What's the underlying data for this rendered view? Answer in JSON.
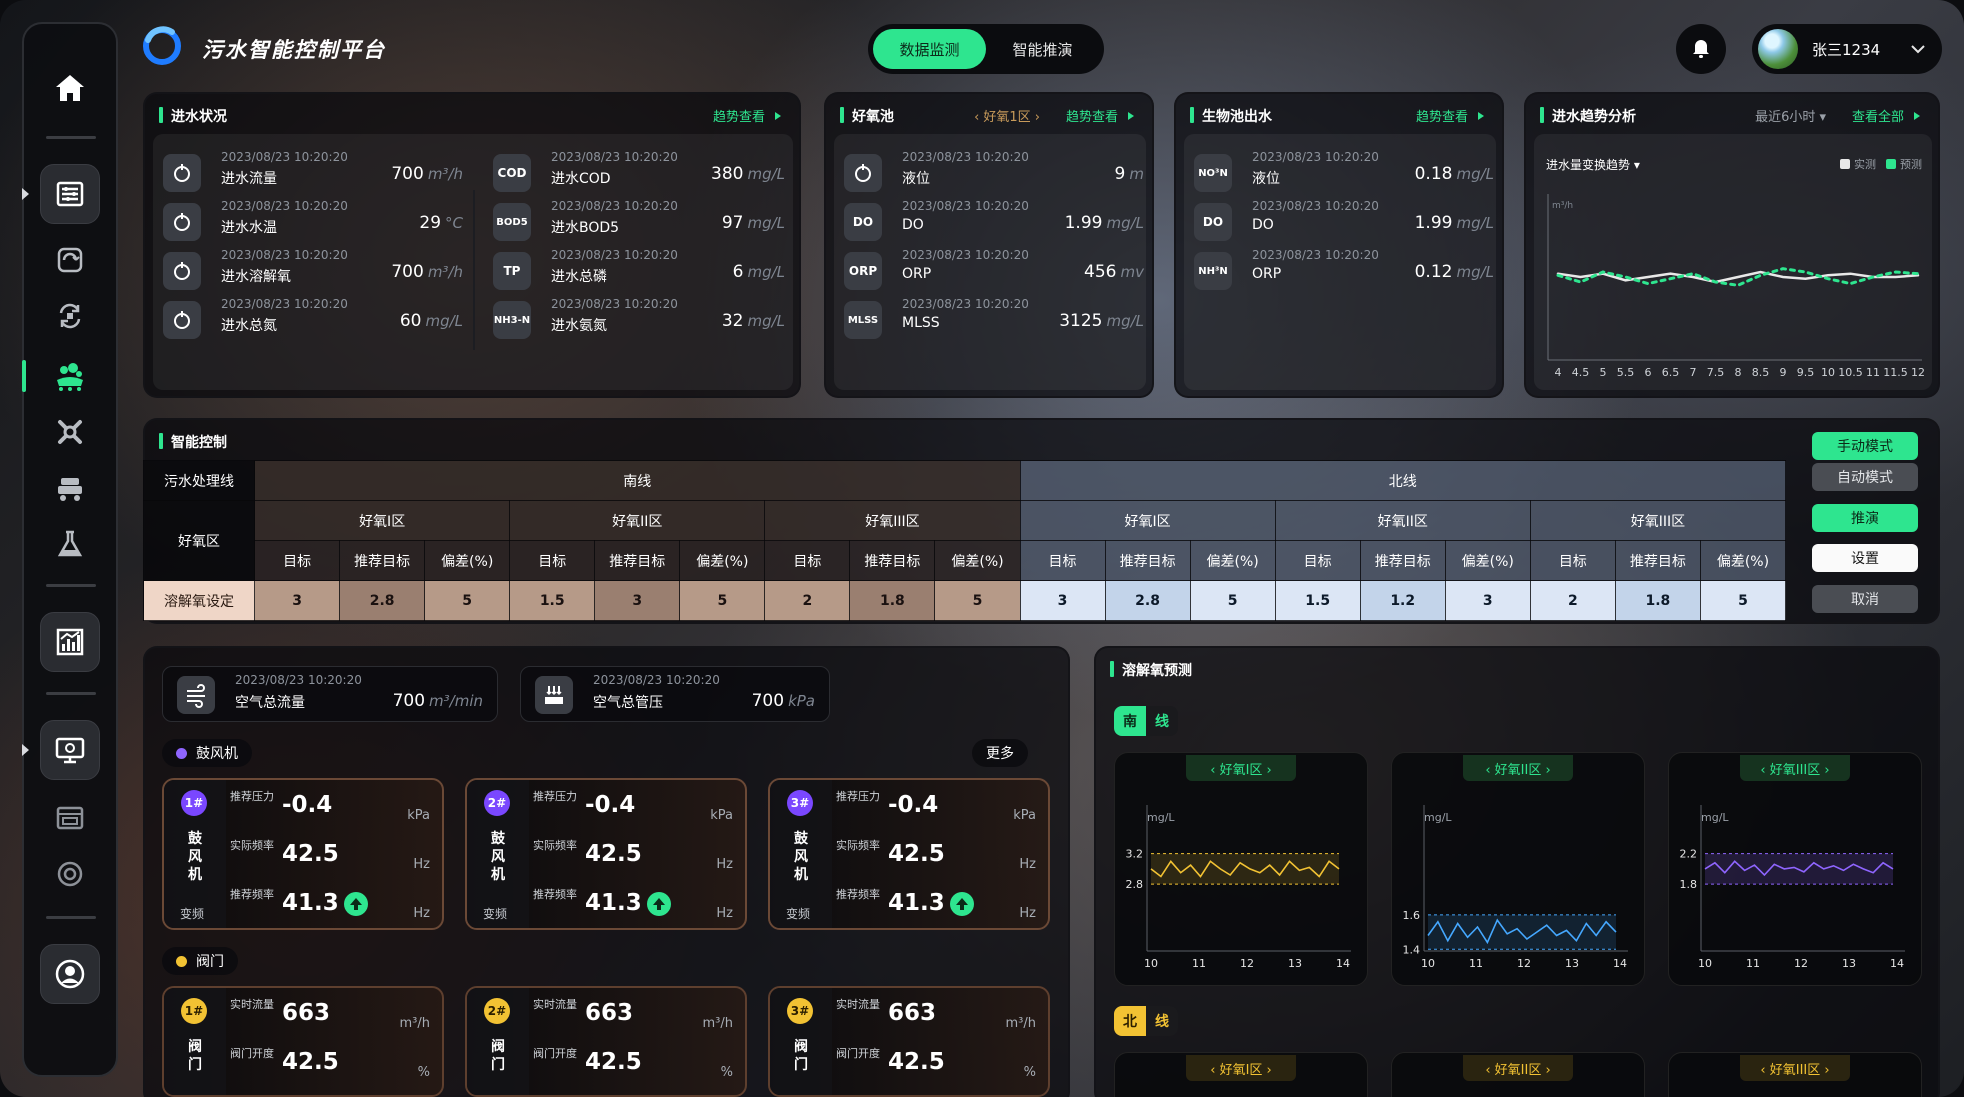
{
  "app": {
    "title": "污水智能控制平台"
  },
  "nav": {
    "tabs": [
      {
        "label": "数据监测",
        "active": true
      },
      {
        "label": "智能推演",
        "active": false
      }
    ]
  },
  "user": {
    "name": "张三1234"
  },
  "sidebar": {
    "items": [
      "home-icon",
      "dashboard-icon",
      "control-icon",
      "sync-icon",
      "aeration-icon",
      "gear-icon",
      "truck-icon",
      "flask-icon",
      "chart-icon",
      "monitor-icon",
      "browser-icon",
      "settings-icon",
      "user-icon"
    ]
  },
  "inflow": {
    "title": "进水状况",
    "link": "趋势查看",
    "left": [
      {
        "time": "2023/08/23  10:20:20",
        "name": "进水流量",
        "value": "700",
        "unit": "m³/h",
        "icon": "drop-icon"
      },
      {
        "time": "2023/08/23  10:20:20",
        "name": "进水水温",
        "value": "29",
        "unit": "°C",
        "icon": "thermo-icon"
      },
      {
        "time": "2023/08/23  10:20:20",
        "name": "进水溶解氧",
        "value": "700",
        "unit": "m³/h",
        "icon": "o2-icon"
      },
      {
        "time": "2023/08/23  10:20:20",
        "name": "进水总氮",
        "value": "60",
        "unit": "mg/L",
        "icon": "tn-icon"
      }
    ],
    "right": [
      {
        "time": "2023/08/23  10:20:20",
        "name": "进水COD",
        "value": "380",
        "unit": "mg/L",
        "icon": "COD"
      },
      {
        "time": "2023/08/23  10:20:20",
        "name": "进水BOD5",
        "value": "97",
        "unit": "mg/L",
        "icon": "BOD5"
      },
      {
        "time": "2023/08/23  10:20:20",
        "name": "进水总磷",
        "value": "6",
        "unit": "mg/L",
        "icon": "TP"
      },
      {
        "time": "2023/08/23  10:20:20",
        "name": "进水氨氮",
        "value": "32",
        "unit": "mg/L",
        "icon": "NH3-N"
      }
    ]
  },
  "aerobic": {
    "title": "好氧池",
    "zone": "‹ 好氧1区 ›",
    "link": "趋势查看",
    "items": [
      {
        "time": "2023/08/23  10:20:20",
        "name": "液位",
        "value": "9",
        "unit": "m",
        "icon": "level-icon"
      },
      {
        "time": "2023/08/23  10:20:20",
        "name": "DO",
        "value": "1.99",
        "unit": "mg/L",
        "icon": "DO"
      },
      {
        "time": "2023/08/23  10:20:20",
        "name": "ORP",
        "value": "456",
        "unit": "mv",
        "icon": "ORP"
      },
      {
        "time": "2023/08/23  10:20:20",
        "name": "MLSS",
        "value": "3125",
        "unit": "mg/L",
        "icon": "MLSS"
      }
    ]
  },
  "bio_out": {
    "title": "生物池出水",
    "link": "趋势查看",
    "items": [
      {
        "time": "2023/08/23  10:20:20",
        "name": "液位",
        "value": "0.18",
        "unit": "mg/L",
        "icon": "NO³N"
      },
      {
        "time": "2023/08/23  10:20:20",
        "name": "DO",
        "value": "1.99",
        "unit": "mg/L",
        "icon": "DO"
      },
      {
        "time": "2023/08/23  10:20:20",
        "name": "ORP",
        "value": "0.12",
        "unit": "mg/L",
        "icon": "NH³N"
      }
    ]
  },
  "trend": {
    "title": "进水趋势分析",
    "range": "最近6小时 ▾",
    "link": "查看全部",
    "subtitle": "进水量变换趋势 ▾",
    "legend_actual": "实测",
    "legend_pred": "预测",
    "unit": "m³/h"
  },
  "chart_data": {
    "type": "line",
    "x": [
      4,
      4.5,
      5,
      5.5,
      6,
      6.5,
      7,
      7.5,
      8,
      8.5,
      9,
      9.5,
      10,
      10.5,
      11,
      11.5,
      12
    ],
    "series": [
      {
        "name": "实测",
        "values": [
          0.52,
          0.5,
          0.52,
          0.48,
          0.5,
          0.52,
          0.5,
          0.47,
          0.5,
          0.53,
          0.5,
          0.49,
          0.51,
          0.52,
          0.5,
          0.5,
          0.51
        ]
      },
      {
        "name": "预测",
        "values": [
          0.51,
          0.47,
          0.53,
          0.5,
          0.46,
          0.49,
          0.52,
          0.47,
          0.45,
          0.51,
          0.55,
          0.53,
          0.49,
          0.46,
          0.5,
          0.53,
          0.52
        ]
      }
    ],
    "ylabel": "m³/h"
  },
  "control": {
    "title": "智能控制",
    "line_label": "污水处理线",
    "south": "南线",
    "north": "北线",
    "zone_label": "好氧区",
    "zones": [
      "好氧I区",
      "好氧II区",
      "好氧III区",
      "好氧I区",
      "好氧II区",
      "好氧III区"
    ],
    "cols": [
      "目标",
      "推荐目标",
      "偏差(%)"
    ],
    "row_label": "溶解氧设定",
    "values": [
      [
        "3",
        "2.8",
        "5"
      ],
      [
        "1.5",
        "3",
        "5"
      ],
      [
        "2",
        "1.8",
        "5"
      ],
      [
        "3",
        "2.8",
        "5"
      ],
      [
        "1.5",
        "1.2",
        "3"
      ],
      [
        "2",
        "1.8",
        "5"
      ]
    ],
    "buttons": {
      "manual": "手动模式",
      "auto": "自动模式",
      "deduce": "推演",
      "set": "设置",
      "cancel": "取消"
    }
  },
  "air": {
    "flow": {
      "time": "2023/08/23  10:20:20",
      "name": "空气总流量",
      "value": "700",
      "unit": "m³/min"
    },
    "pressure": {
      "time": "2023/08/23  10:20:20",
      "name": "空气总管压",
      "value": "700",
      "unit": "kPa"
    }
  },
  "blowers": {
    "label": "鼓风机",
    "more": "更多",
    "items": [
      {
        "badge": "1#",
        "name": "鼓风机",
        "mode": "变频",
        "pressure_label": "推荐压力",
        "pressure": "-0.4",
        "pressure_unit": "kPa",
        "freq_label": "实际频率",
        "freq": "42.5",
        "freq_unit": "Hz",
        "rec_label": "推荐频率",
        "rec": "41.3",
        "rec_unit": "Hz"
      },
      {
        "badge": "2#",
        "name": "鼓风机",
        "mode": "变频",
        "pressure_label": "推荐压力",
        "pressure": "-0.4",
        "pressure_unit": "kPa",
        "freq_label": "实际频率",
        "freq": "42.5",
        "freq_unit": "Hz",
        "rec_label": "推荐频率",
        "rec": "41.3",
        "rec_unit": "Hz"
      },
      {
        "badge": "3#",
        "name": "鼓风机",
        "mode": "变频",
        "pressure_label": "推荐压力",
        "pressure": "-0.4",
        "pressure_unit": "kPa",
        "freq_label": "实际频率",
        "freq": "42.5",
        "freq_unit": "Hz",
        "rec_label": "推荐频率",
        "rec": "41.3",
        "rec_unit": "Hz"
      }
    ]
  },
  "valves": {
    "label": "阀门",
    "items": [
      {
        "badge": "1#",
        "name": "阀门",
        "flow_label": "实时流量",
        "flow": "663",
        "flow_unit": "m³/h",
        "open_label": "阀门开度",
        "open": "42.5",
        "open_unit": "%"
      },
      {
        "badge": "2#",
        "name": "阀门",
        "flow_label": "实时流量",
        "flow": "663",
        "flow_unit": "m³/h",
        "open_label": "阀门开度",
        "open": "42.5",
        "open_unit": "%"
      },
      {
        "badge": "3#",
        "name": "阀门",
        "flow_label": "实时流量",
        "flow": "663",
        "flow_unit": "m³/h",
        "open_label": "阀门开度",
        "open": "42.5",
        "open_unit": "%"
      }
    ]
  },
  "do_pred": {
    "title": "溶解氧预测",
    "south": {
      "a": "南",
      "b": "线"
    },
    "north": {
      "a": "北",
      "b": "线"
    },
    "unit": "mg/L",
    "xticks": [
      "10",
      "11",
      "12",
      "13",
      "14"
    ],
    "charts": [
      {
        "zone": "‹ 好氧I区 ›",
        "band": [
          2.8,
          3.2
        ],
        "color": "#f2c233",
        "fill": "rgba(242,194,51,0.15)",
        "values": [
          3.0,
          2.9,
          3.1,
          2.95,
          3.05,
          2.9,
          3.1,
          3.0,
          2.92,
          3.08,
          3.0,
          2.95,
          3.05,
          2.92,
          3.1,
          2.98,
          3.02,
          2.9,
          3.1,
          3.0
        ]
      },
      {
        "zone": "‹ 好氧II区 ›",
        "band": [
          1.4,
          1.6
        ],
        "color": "#45a8ff",
        "fill": "rgba(69,168,255,0.15)",
        "values": [
          1.48,
          1.56,
          1.45,
          1.55,
          1.47,
          1.53,
          1.44,
          1.57,
          1.49,
          1.52,
          1.46,
          1.5,
          1.54,
          1.48,
          1.51,
          1.45,
          1.55,
          1.48,
          1.56,
          1.5
        ]
      },
      {
        "zone": "‹ 好氧III区 ›",
        "band": [
          1.8,
          2.2
        ],
        "color": "#8f65ff",
        "fill": "rgba(143,101,255,0.18)",
        "values": [
          2.0,
          2.08,
          1.95,
          2.1,
          1.98,
          2.05,
          1.92,
          2.06,
          2.0,
          2.02,
          1.96,
          2.08,
          2.0,
          2.04,
          1.98,
          2.06,
          2.0,
          1.95,
          2.08,
          2.0
        ]
      }
    ],
    "north_zones": [
      "‹ 好氧I区 ›",
      "‹ 好氧II区 ›",
      "‹ 好氧III区 ›"
    ]
  },
  "trend_xticks": [
    "4",
    "4.5",
    "5",
    "5.5",
    "6",
    "6.5",
    "7",
    "7.5",
    "8",
    "8.5",
    "9",
    "9.5",
    "10",
    "10.5",
    "11",
    "11.5",
    "12"
  ],
  "colors": {
    "accent": "#2ee58f"
  }
}
